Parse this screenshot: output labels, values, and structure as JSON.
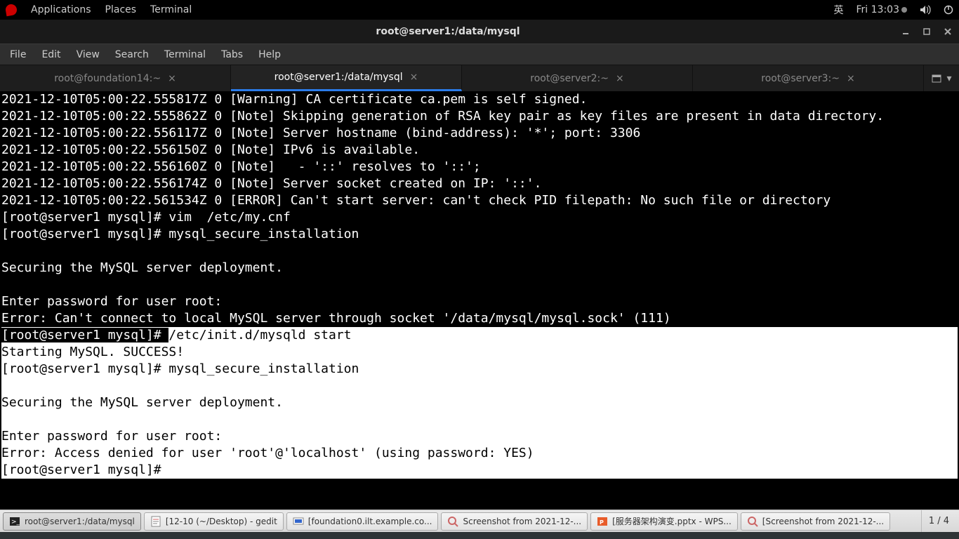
{
  "top_panel": {
    "applications": "Applications",
    "places": "Places",
    "terminal": "Terminal",
    "ime": "英",
    "clock": "Fri 13:03"
  },
  "window": {
    "title": "root@server1:/data/mysql"
  },
  "menubar": {
    "file": "File",
    "edit": "Edit",
    "view": "View",
    "search": "Search",
    "terminal": "Terminal",
    "tabs": "Tabs",
    "help": "Help"
  },
  "tabs": [
    {
      "label": "root@foundation14:~",
      "active": false
    },
    {
      "label": "root@server1:/data/mysql",
      "active": true
    },
    {
      "label": "root@server2:~",
      "active": false
    },
    {
      "label": "root@server3:~",
      "active": false
    }
  ],
  "terminal": {
    "lines_top": "2021-12-10T05:00:22.555817Z 0 [Warning] CA certificate ca.pem is self signed.\n2021-12-10T05:00:22.555862Z 0 [Note] Skipping generation of RSA key pair as key files are present in data directory.\n2021-12-10T05:00:22.556117Z 0 [Note] Server hostname (bind-address): '*'; port: 3306\n2021-12-10T05:00:22.556150Z 0 [Note] IPv6 is available.\n2021-12-10T05:00:22.556160Z 0 [Note]   - '::' resolves to '::';\n2021-12-10T05:00:22.556174Z 0 [Note] Server socket created on IP: '::'.\n2021-12-10T05:00:22.561534Z 0 [ERROR] Can't start server: can't check PID filepath: No such file or directory\n[root@server1 mysql]# vim  /etc/my.cnf\n[root@server1 mysql]# mysql_secure_installation \n\nSecuring the MySQL server deployment.\n\nEnter password for user root: \nError: Can't connect to local MySQL server through socket '/data/mysql/mysql.sock' (111)",
    "prompt_hl_prefix": "[root@server1 mysql]# ",
    "hl_cmd": "/etc/init.d/mysqld start",
    "lines_hl": "Starting MySQL. SUCCESS! \n[root@server1 mysql]# mysql_secure_installation \n\nSecuring the MySQL server deployment.\n\nEnter password for user root: \nError: Access denied for user 'root'@'localhost' (using password: YES)",
    "final_prompt": "[root@server1 mysql]# "
  },
  "taskbar": {
    "items": [
      {
        "label": "root@server1:/data/mysql",
        "active": true,
        "icon": "terminal"
      },
      {
        "label": "[12-10 (~/Desktop) - gedit",
        "active": false,
        "icon": "gedit"
      },
      {
        "label": "[foundation0.ilt.example.co...",
        "active": false,
        "icon": "vm"
      },
      {
        "label": "Screenshot from 2021-12-...",
        "active": false,
        "icon": "image"
      },
      {
        "label": "[服务器架构演变.pptx - WPS...",
        "active": false,
        "icon": "wps"
      },
      {
        "label": "[Screenshot from 2021-12-...",
        "active": false,
        "icon": "image"
      }
    ],
    "workspace": "1 / 4"
  }
}
